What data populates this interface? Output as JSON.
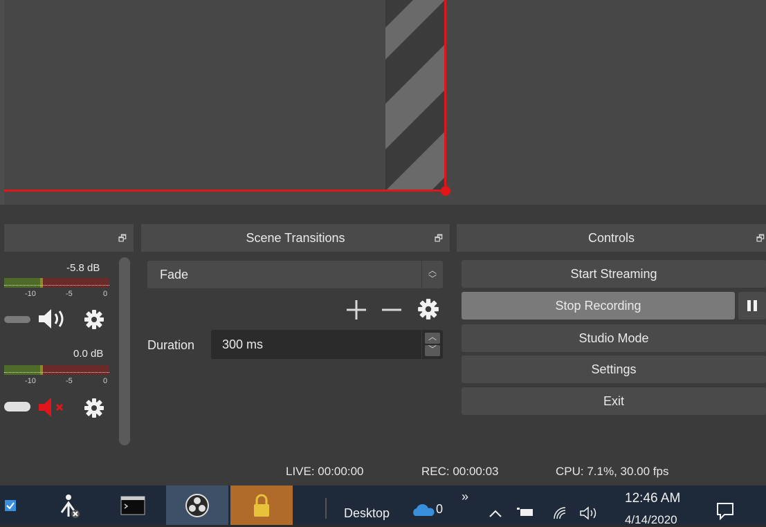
{
  "scene_transitions": {
    "title": "Scene Transitions",
    "transition_value": "Fade",
    "duration_label": "Duration",
    "duration_value": "300 ms",
    "add_icon": "plus-icon",
    "remove_icon": "minus-icon",
    "config_icon": "gear-icon"
  },
  "controls": {
    "title": "Controls",
    "start_streaming": "Start Streaming",
    "stop_recording": "Stop Recording",
    "studio_mode": "Studio Mode",
    "settings": "Settings",
    "exit": "Exit"
  },
  "mixer": {
    "tracks": [
      {
        "db": "-5.8 dB",
        "scale": [
          "-10",
          "-5",
          "0"
        ],
        "muted": false
      },
      {
        "db": "0.0 dB",
        "scale": [
          "-10",
          "-5",
          "0"
        ],
        "muted": true
      }
    ]
  },
  "status": {
    "live": "LIVE: 00:00:00",
    "rec": "REC: 00:00:03",
    "cpu": "CPU: 7.1%, 30.00 fps"
  },
  "taskbar": {
    "desktop_label": "Desktop",
    "onedrive_count": "0",
    "overflow": "»",
    "time": "12:46 AM",
    "date": "4/14/2020"
  },
  "colors": {
    "selection": "#e0161b",
    "panel": "#3b3b3b",
    "button": "#4a4a4a",
    "active_button": "#7a7a7a"
  }
}
